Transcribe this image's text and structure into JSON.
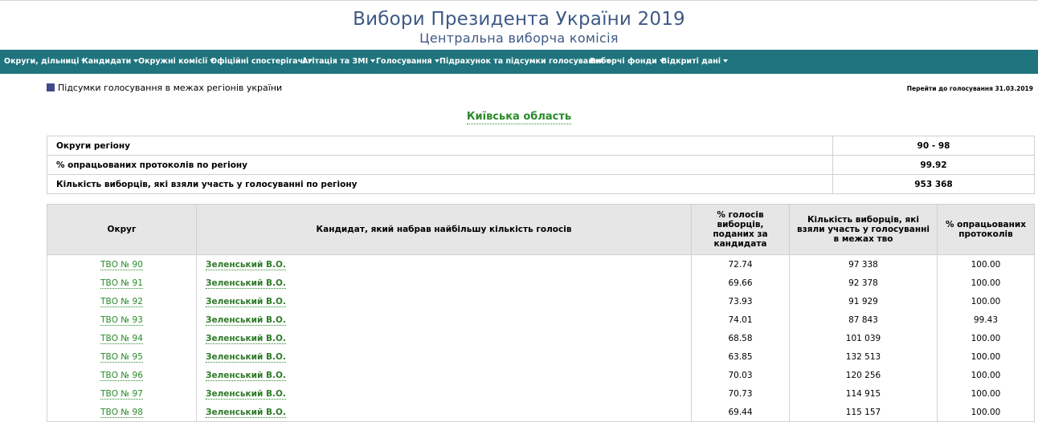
{
  "header": {
    "title": "Вибори Президента України 2019",
    "subtitle": "Центральна виборча комісія"
  },
  "nav": {
    "items": [
      {
        "label": "Округи, дільниці"
      },
      {
        "label": "Кандидати"
      },
      {
        "label": "Окружні комісії"
      },
      {
        "label": "Офіційні спостерігачі"
      },
      {
        "label": "Агітація та ЗМІ"
      },
      {
        "label": "Голосування"
      },
      {
        "label": "Підрахунок та підсумки голосування"
      },
      {
        "label": "Виборчі фонди"
      },
      {
        "label": "Відкриті дані"
      }
    ]
  },
  "breadcrumb": "Підсумки голосування в межах регіонів україни",
  "goto_link": "Перейти до голосування 31.03.2019",
  "region_title": "Київська область",
  "summary": [
    {
      "label": "Округи регіону",
      "value": "90 - 98"
    },
    {
      "label": "% опрацьованих протоколів по регіону",
      "value": "99.92"
    },
    {
      "label": "Кількість виборців, які взяли участь у голосуванні по регіону",
      "value": "953 368"
    }
  ],
  "table": {
    "headers": {
      "district": "Округ",
      "candidate": "Кандидат, який набрав найбільшу кількість голосів",
      "percent": "% голосів виборців, поданих за кандидата",
      "voters": "Кількість виборців, які взяли участь у голосуванні в межах тво",
      "processed": "% опрацьованих протоколів"
    },
    "rows": [
      {
        "district": "ТВО № 90",
        "candidate": "Зеленський В.О.",
        "percent": "72.74",
        "voters": "97 338",
        "processed": "100.00"
      },
      {
        "district": "ТВО № 91",
        "candidate": "Зеленський В.О.",
        "percent": "69.66",
        "voters": "92 378",
        "processed": "100.00"
      },
      {
        "district": "ТВО № 92",
        "candidate": "Зеленський В.О.",
        "percent": "73.93",
        "voters": "91 929",
        "processed": "100.00"
      },
      {
        "district": "ТВО № 93",
        "candidate": "Зеленський В.О.",
        "percent": "74.01",
        "voters": "87 843",
        "processed": "99.43"
      },
      {
        "district": "ТВО № 94",
        "candidate": "Зеленський В.О.",
        "percent": "68.58",
        "voters": "101 039",
        "processed": "100.00"
      },
      {
        "district": "ТВО № 95",
        "candidate": "Зеленський В.О.",
        "percent": "63.85",
        "voters": "132 513",
        "processed": "100.00"
      },
      {
        "district": "ТВО № 96",
        "candidate": "Зеленський В.О.",
        "percent": "70.03",
        "voters": "120 256",
        "processed": "100.00"
      },
      {
        "district": "ТВО № 97",
        "candidate": "Зеленський В.О.",
        "percent": "70.73",
        "voters": "114 915",
        "processed": "100.00"
      },
      {
        "district": "ТВО № 98",
        "candidate": "Зеленський В.О.",
        "percent": "69.44",
        "voters": "115 157",
        "processed": "100.00"
      }
    ]
  },
  "colors": {
    "nav_bg": "#20747d",
    "title": "#3e5a85",
    "link": "#2a8a2a",
    "header_row_bg": "#e6e6e6"
  }
}
